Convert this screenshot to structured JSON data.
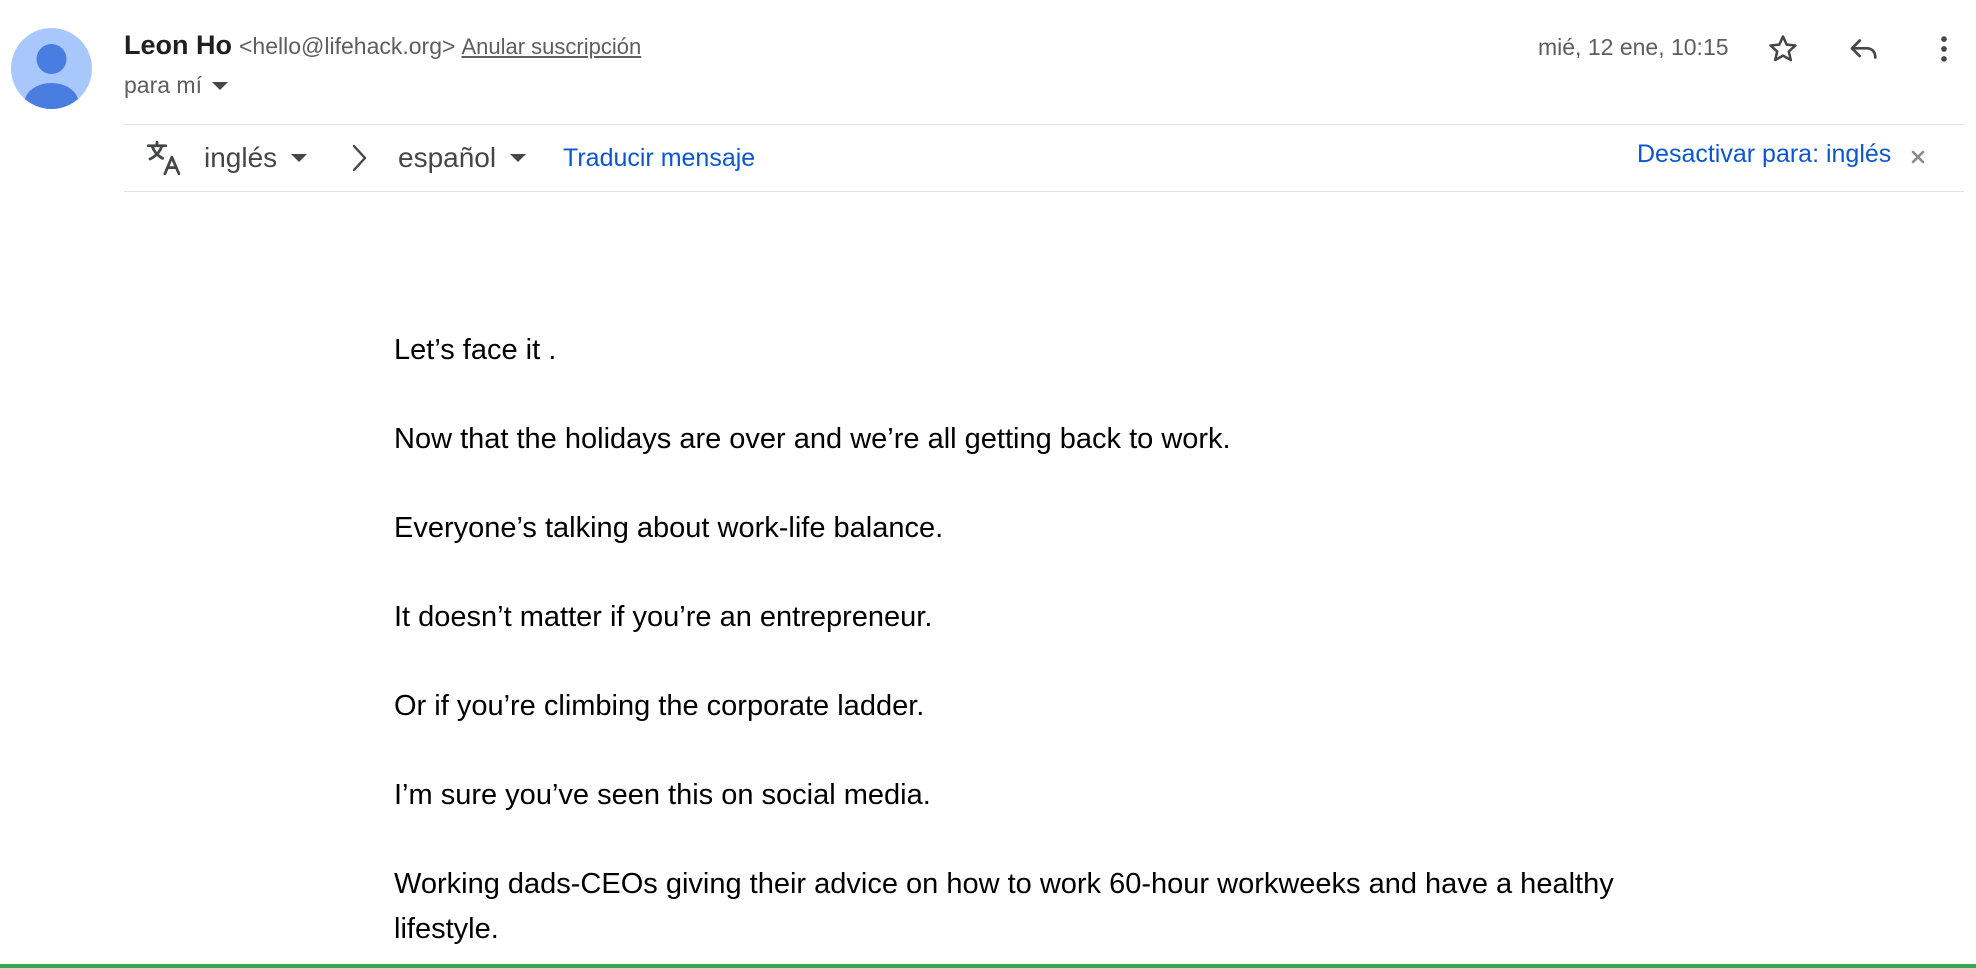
{
  "header": {
    "sender_name": "Leon Ho",
    "sender_email": "<hello@lifehack.org>",
    "unsubscribe_label": "Anular suscripción",
    "recipient_label": "para mí",
    "date": "mié, 12 ene, 10:15",
    "icons": [
      "avatar-icon",
      "star-icon",
      "reply-icon",
      "more-vert-icon",
      "chevron-down-icon"
    ]
  },
  "translation": {
    "source_language": "inglés",
    "target_language": "español",
    "translate_label": "Traducir mensaje",
    "disable_label": "Desactivar para: inglés",
    "icons": [
      "translate-icon",
      "chevron-right-icon",
      "close-icon"
    ]
  },
  "body": {
    "paragraphs": [
      "Let’s face it .",
      "Now that the holidays are over and we’re all getting back to work.",
      "Everyone’s talking about work-life balance.",
      "It doesn’t matter if you’re an entrepreneur.",
      "Or if you’re climbing the corporate ladder.",
      "I’m sure you’ve seen this on social media.",
      "Working dads-CEOs giving their advice on how to work 60-hour workweeks and have a healthy lifestyle."
    ]
  },
  "colors": {
    "link": "#0b57d0",
    "avatar_bg": "#a8c7fa",
    "avatar_fg": "#4a7de0",
    "bottom_accent": "#34a853"
  }
}
